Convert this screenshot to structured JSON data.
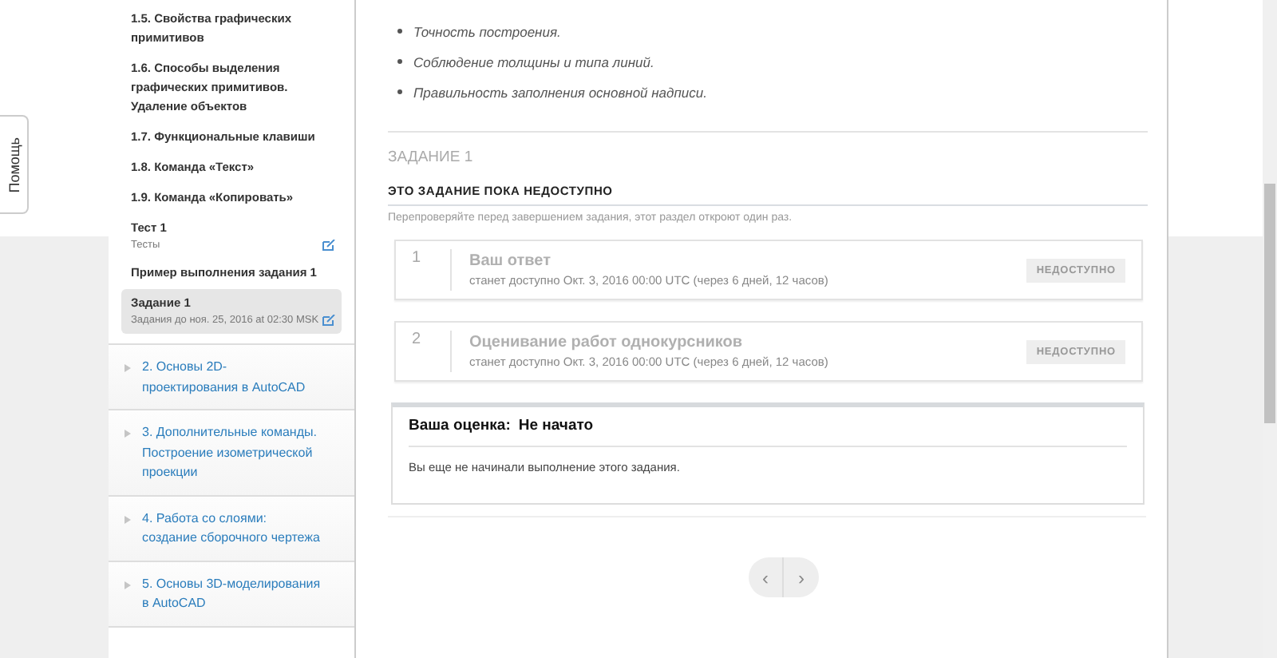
{
  "help_tab": {
    "label": "Помощь"
  },
  "sidebar": {
    "items": [
      {
        "kind": "lesson",
        "title": "1.5. Свойства графических примитивов",
        "selected": false
      },
      {
        "kind": "lesson",
        "title": "1.6. Способы выделения графических примитивов. Удаление объектов",
        "selected": false
      },
      {
        "kind": "lesson",
        "title": "1.7. Функциональные клавиши",
        "selected": false
      },
      {
        "kind": "lesson",
        "title": "1.8. Команда «Текст»",
        "selected": false
      },
      {
        "kind": "lesson",
        "title": "1.9. Команда «Копировать»",
        "selected": false
      },
      {
        "kind": "graded",
        "title": "Тест 1",
        "subtitle": "Тесты",
        "selected": false
      },
      {
        "kind": "lesson",
        "title": "Пример выполнения задания 1",
        "selected": false
      },
      {
        "kind": "graded",
        "title": "Задание 1",
        "subtitle": "Задания до ноя. 25, 2016 at 02:30 MSK",
        "selected": true
      }
    ],
    "sections": [
      {
        "title": "2. Основы 2D-проектирования в AutoCAD",
        "expanded": false
      },
      {
        "title": "3. Дополнительные команды. Построение изометрической проекции",
        "expanded": false
      },
      {
        "title": "4. Работа со слоями: создание сборочного чертежа",
        "expanded": false
      },
      {
        "title": "5. Основы 3D-моделирования в AutoCAD",
        "expanded": false
      }
    ]
  },
  "content": {
    "criteria": [
      "Точность построения.",
      "Соблюдение толщины и типа линий.",
      "Правильность заполнения основной надписи."
    ],
    "assignment_heading": "ЗАДАНИЕ 1",
    "status_heading": "ЭТО ЗАДАНИЕ ПОКА НЕДОСТУПНО",
    "status_note": "Перепроверяйте перед завершением задания, этот раздел откроют один раз.",
    "steps": [
      {
        "number": "1",
        "title": "Ваш ответ",
        "availability": "станет доступно Окт. 3, 2016 00:00 UTC (через 6 дней, 12 часов)",
        "badge": "НЕДОСТУПНО",
        "disabled": true
      },
      {
        "number": "2",
        "title": "Оценивание работ однокурсников",
        "availability": "станет доступно Окт. 3, 2016 00:00 UTC (через 6 дней, 12 часов)",
        "badge": "НЕДОСТУПНО",
        "disabled": true
      }
    ],
    "grade": {
      "label": "Ваша оценка:",
      "value": "Не начато",
      "message": "Вы еще не начинали выполнение этого задания."
    },
    "pager": {
      "prev": "‹",
      "next": "›"
    }
  }
}
